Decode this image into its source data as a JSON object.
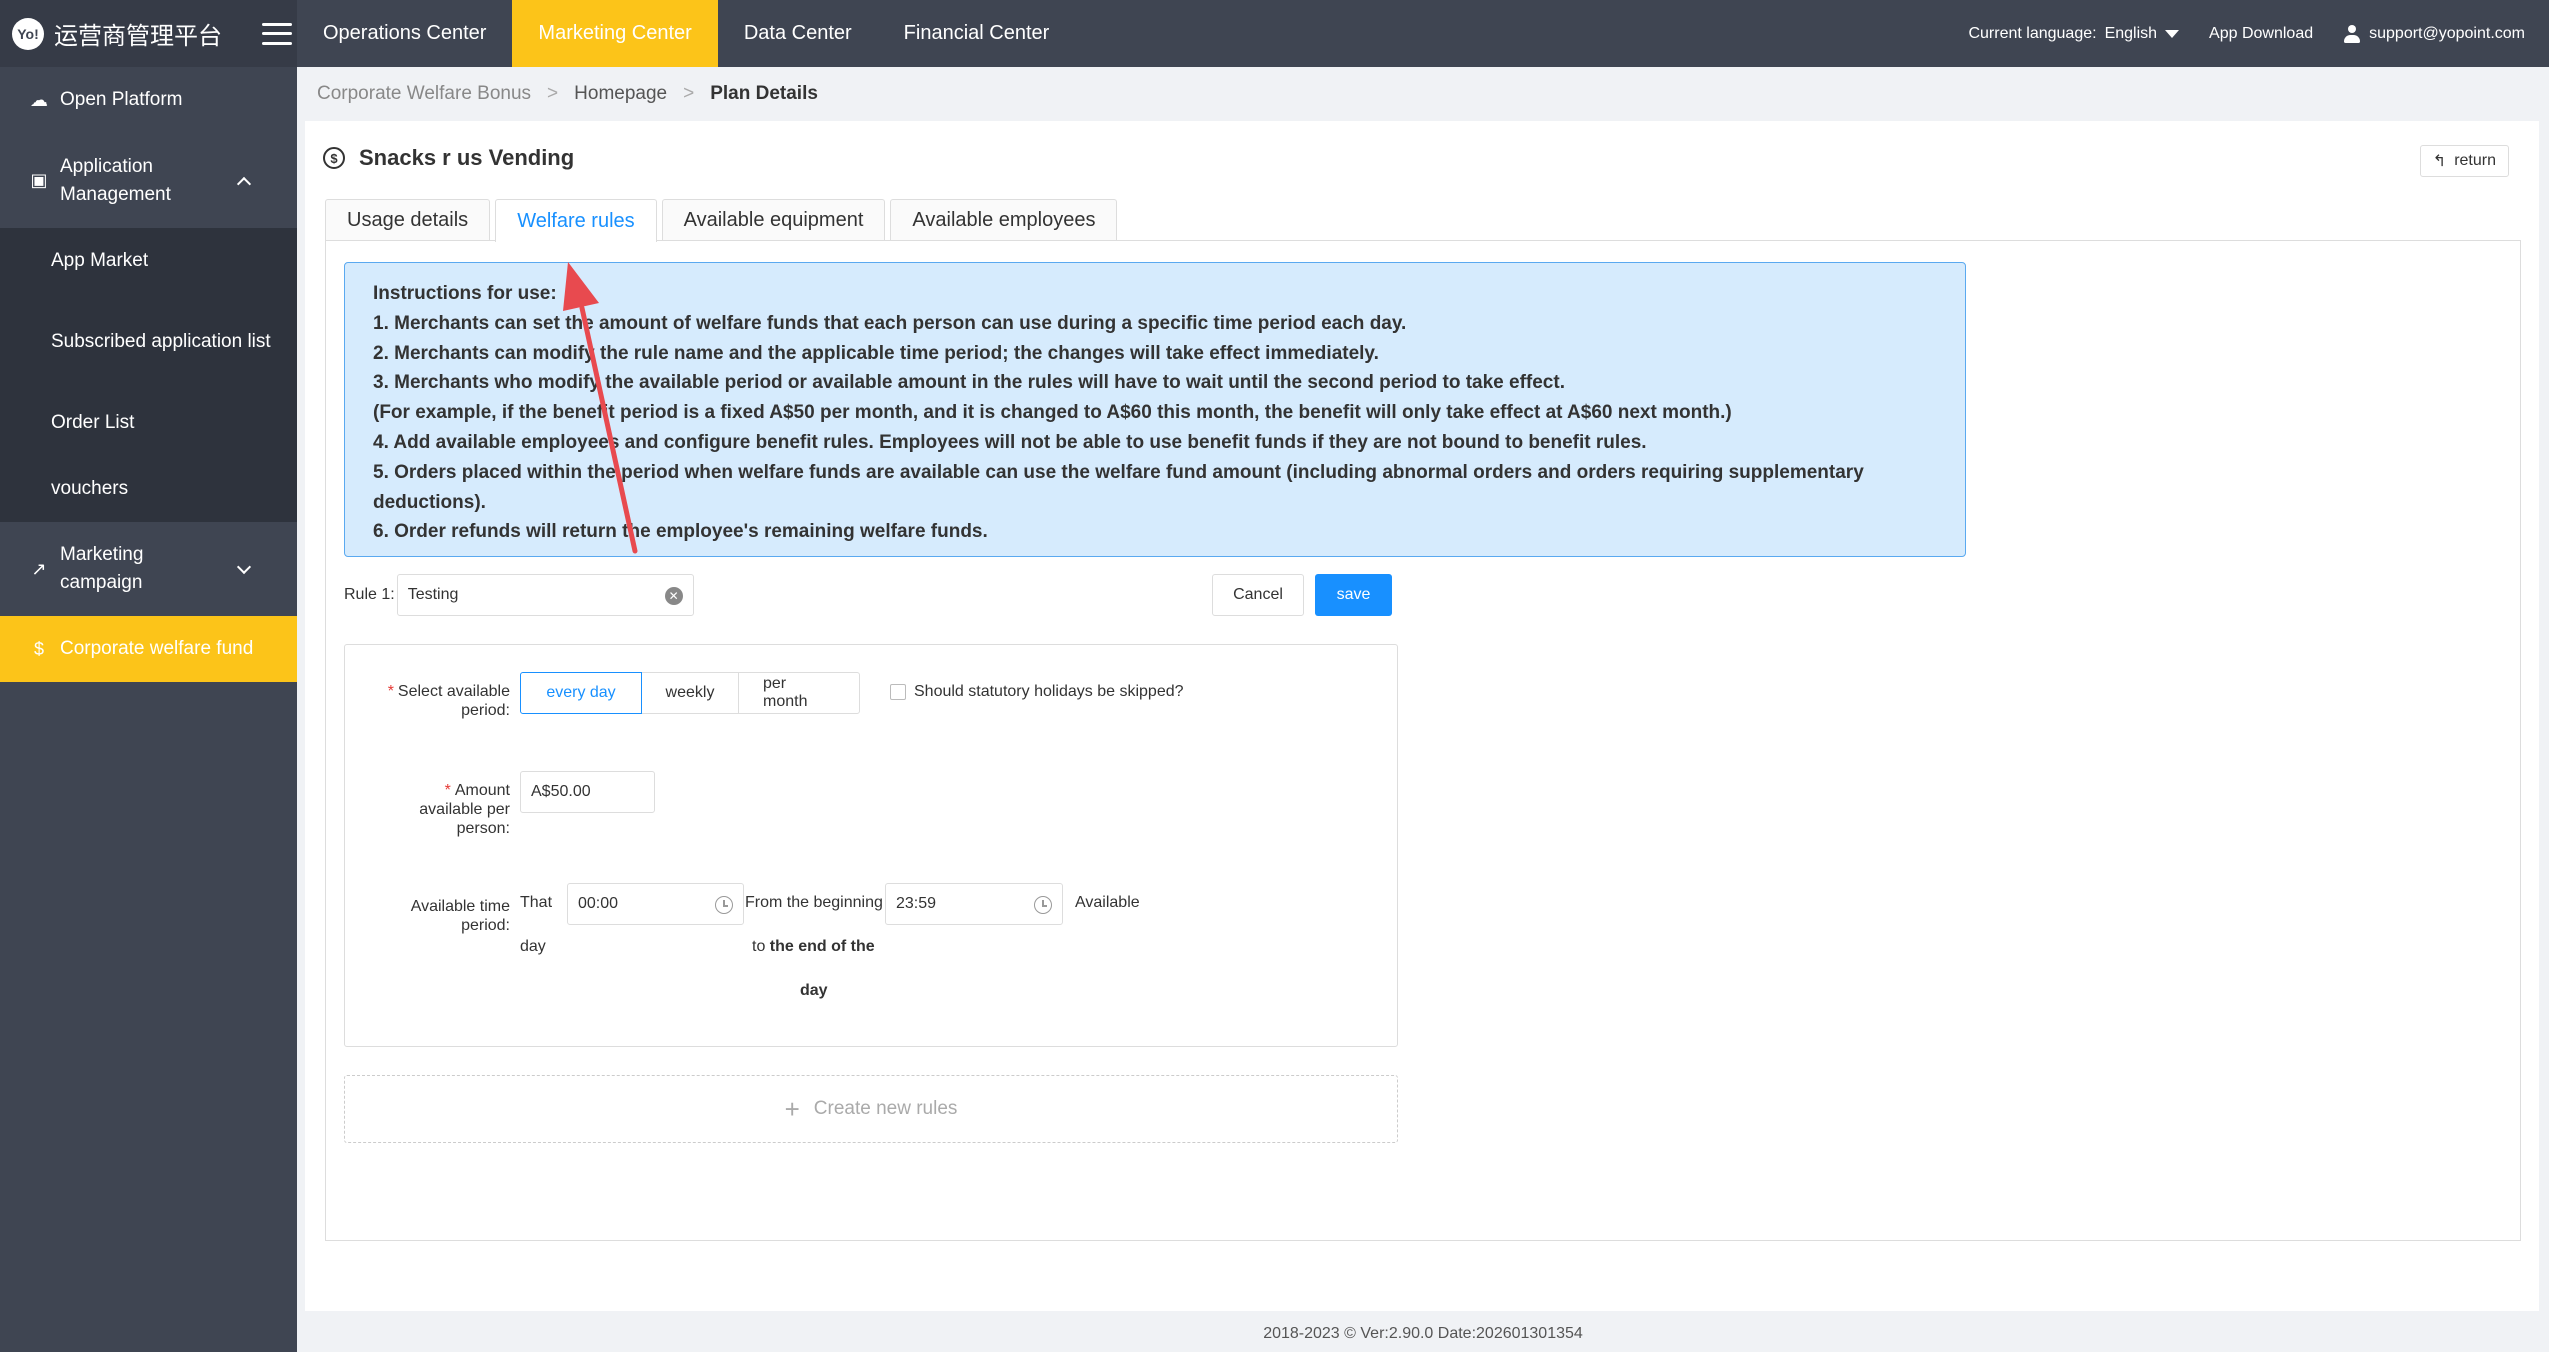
{
  "brand": {
    "logo_text": "Yo!",
    "name": "运营商管理平台"
  },
  "topnav": [
    {
      "label": "Operations Center",
      "active": false
    },
    {
      "label": "Marketing Center",
      "active": true
    },
    {
      "label": "Data Center",
      "active": false
    },
    {
      "label": "Financial Center",
      "active": false
    }
  ],
  "topright": {
    "language_label": "Current language:",
    "language_value": "English",
    "app_download": "App Download",
    "user_email": "support@yopoint.com"
  },
  "sidebar": {
    "open_platform": "Open Platform",
    "app_management": "Application Management",
    "sub_items": [
      "App Market",
      "Subscribed application list",
      "Order List",
      "vouchers"
    ],
    "marketing_campaign": "Marketing campaign",
    "corporate_welfare": "Corporate welfare fund"
  },
  "breadcrumb": {
    "first": "Corporate Welfare Bonus",
    "sep": ">",
    "second": "Homepage",
    "third": "Plan Details"
  },
  "panel": {
    "title": "Snacks r us Vending",
    "return_label": "return",
    "tabs": [
      "Usage details",
      "Welfare rules",
      "Available equipment",
      "Available employees"
    ],
    "active_tab": 1
  },
  "instructions": {
    "heading": "Instructions for use:",
    "lines": [
      "1. Merchants can set the amount of welfare funds that each person can use during a specific time period each day.",
      "2. Merchants can modify the rule name and the applicable time period; the changes will take effect immediately.",
      "3. Merchants who modify the available period or available amount in the rules will have to wait until the second period to take effect.",
      "(For example, if the benefit period is a fixed A$50 per month, and it is changed to A$60 this month, the benefit will only take effect at A$60 next month.)",
      "4. Add available employees and configure benefit rules. Employees will not be able to use benefit funds if they are not bound to benefit rules.",
      "5. Orders placed within the period when welfare funds are available can use the welfare fund amount (including abnormal orders and orders requiring supplementary",
      "deductions).",
      "6. Order refunds will return the employee's remaining welfare funds."
    ]
  },
  "rule": {
    "label": "Rule 1:",
    "name_value": "Testing",
    "cancel": "Cancel",
    "save": "save",
    "period_label_1": "Select available",
    "period_label_2": "period:",
    "periods": [
      "every day",
      "weekly",
      "per month"
    ],
    "active_period": 0,
    "holiday_label": "Should statutory holidays be skipped?",
    "holiday_checked": false,
    "amount_label_1": "Amount",
    "amount_label_2": "available per",
    "amount_label_3": "person:",
    "amount_value": "A$50.00",
    "time_label_1": "Available time",
    "time_label_2": "period:",
    "time_that": "That",
    "time_day": "day",
    "start_time": "00:00",
    "from_beginning": "From the beginning",
    "to_word": "to",
    "end_of_the": "the end of the",
    "end_day": "day",
    "end_time": "23:59",
    "available_word": "Available"
  },
  "create_new_rules": "Create new rules",
  "footer": "2018-2023 © Ver:2.90.0 Date:202601301354",
  "colors": {
    "accent": "#fcc419",
    "primary": "#1890ff",
    "sidebar": "#3f4552",
    "arrow": "#e84a4f"
  }
}
